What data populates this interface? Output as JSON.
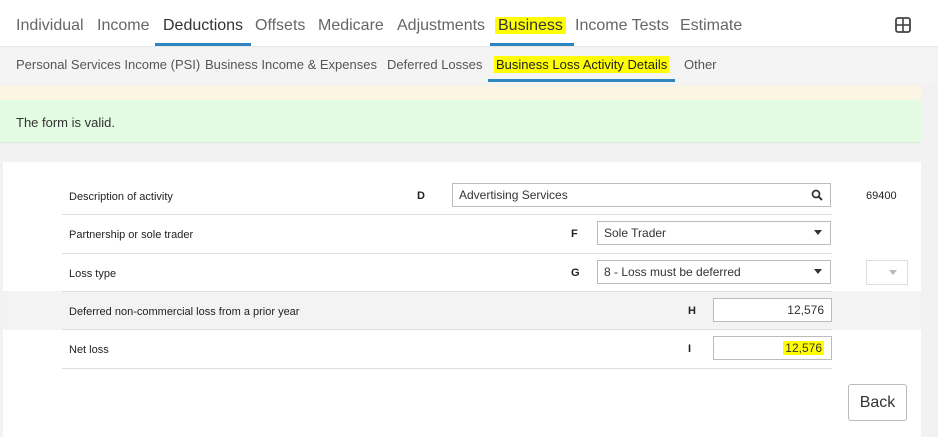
{
  "top_tabs": [
    {
      "label": "Individual"
    },
    {
      "label": "Income"
    },
    {
      "label": "Deductions"
    },
    {
      "label": "Offsets"
    },
    {
      "label": "Medicare"
    },
    {
      "label": "Adjustments"
    },
    {
      "label": "Business"
    },
    {
      "label": "Income Tests"
    },
    {
      "label": "Estimate"
    }
  ],
  "sub_tabs": [
    {
      "label": "Personal Services Income (PSI)"
    },
    {
      "label": "Business Income & Expenses"
    },
    {
      "label": "Deferred Losses"
    },
    {
      "label": "Business Loss Activity Details"
    },
    {
      "label": "Other"
    }
  ],
  "message": "The form is valid.",
  "form": {
    "rows": [
      {
        "label": "Description of activity",
        "code": "D",
        "value": "Advertising Services",
        "extra": "69400",
        "icon": "search-icon"
      },
      {
        "label": "Partnership or sole trader",
        "code": "F",
        "value": "Sole Trader",
        "icon": "caret-down-icon"
      },
      {
        "label": "Loss type",
        "code": "G",
        "value": "8 - Loss must be deferred",
        "icon": "caret-down-icon"
      },
      {
        "label": "Deferred non-commercial loss from a prior year",
        "code": "H",
        "value": "12,576"
      },
      {
        "label": "Net loss",
        "code": "I",
        "value": "12,576"
      }
    ]
  },
  "back_label": "Back",
  "colors": {
    "accent": "#2e86c1",
    "highlight": "#ffff00",
    "valid_bg": "#e3fbe3"
  }
}
